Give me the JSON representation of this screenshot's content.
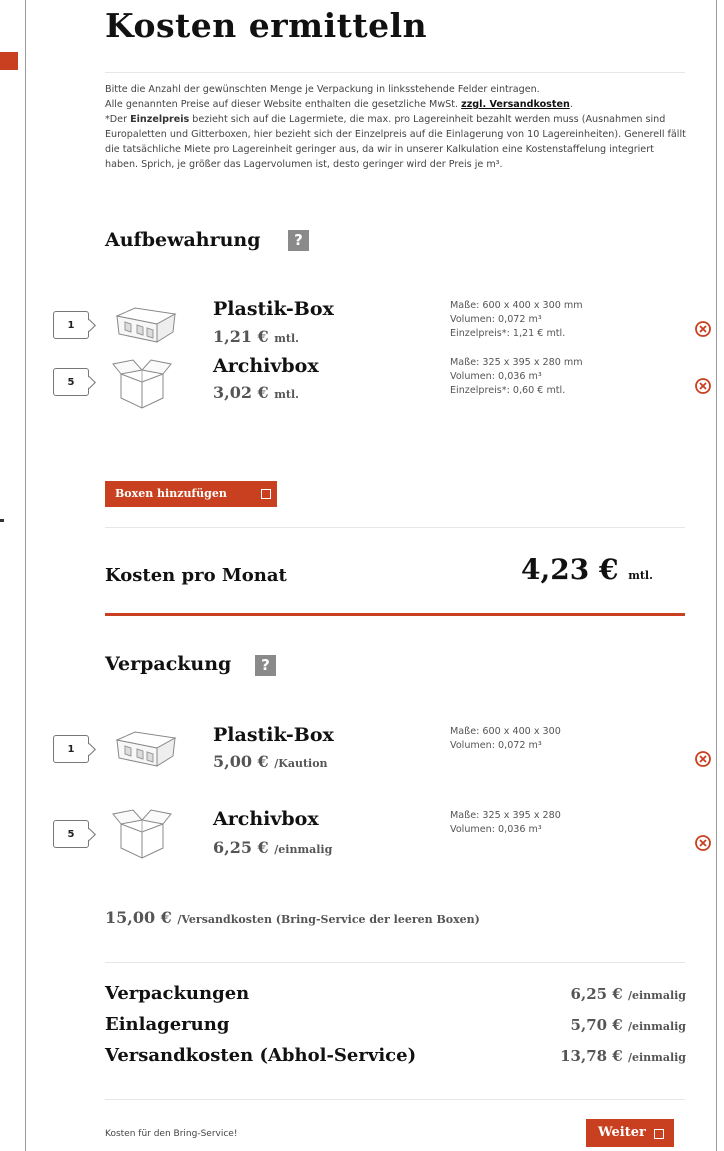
{
  "page_title": "Kosten ermitteln",
  "intro": {
    "line1": "Bitte die Anzahl der gewünschten Menge je Verpackung in linksstehende Felder eintragen.",
    "line2_pre": "Alle genannten Preise auf dieser Website enthalten die gesetzliche MwSt. ",
    "line2_link": "zzgl. Versandkosten",
    "line2_post": ".",
    "line3_pre": "*Der ",
    "line3_bold": "Einzelpreis",
    "line3_post": " bezieht sich auf die Lagermiete, die max. pro Lagereinheit bezahlt werden muss (Ausnahmen sind Europaletten und Gitterboxen, hier bezieht sich der Einzelpreis auf die Einlagerung von 10 Lagereinheiten). Generell fällt die tatsächliche Miete pro Lagereinheit geringer aus, da wir in unserer Kalkulation eine Kostenstaffelung integriert haben. Sprich, je größer das Lagervolumen ist, desto geringer wird der Preis je m³."
  },
  "storage": {
    "title": "Aufbewahrung",
    "help": "?",
    "items": [
      {
        "qty": "1",
        "name": "Plastik-Box",
        "price": "1,21 €",
        "unit": "mtl.",
        "spec1": "Maße: 600 x 400 x 300 mm",
        "spec2": "Volumen: 0,072 m³",
        "spec3": "Einzelpreis*: 1,21 € mtl."
      },
      {
        "qty": "5",
        "name": "Archivbox",
        "price": "3,02 €",
        "unit": "mtl.",
        "spec1": "Maße: 325 x 395 x 280 mm",
        "spec2": "Volumen: 0,036 m³",
        "spec3": "Einzelpreis*: 0,60 € mtl."
      }
    ],
    "add_button": "Boxen hinzufügen"
  },
  "monthly": {
    "label": "Kosten pro Monat",
    "value": "4,23 €",
    "unit": "mtl."
  },
  "packaging": {
    "title": "Verpackung",
    "help": "?",
    "items": [
      {
        "qty": "1",
        "name": "Plastik-Box",
        "price": "5,00 €",
        "unit": "/Kaution",
        "spec1": "Maße: 600 x 400 x 300",
        "spec2": "Volumen: 0,072 m³"
      },
      {
        "qty": "5",
        "name": "Archivbox",
        "price": "6,25 €",
        "unit": "/einmalig",
        "spec1": "Maße: 325 x 395 x 280",
        "spec2": "Volumen: 0,036 m³"
      }
    ],
    "shipping_value": "15,00 €",
    "shipping_text": "/Versandkosten (Bring-Service der leeren Boxen)"
  },
  "summary": [
    {
      "label": "Verpackungen",
      "value": "6,25 €",
      "unit": "/einmalig"
    },
    {
      "label": "Einlagerung",
      "value": "5,70 €",
      "unit": "/einmalig"
    },
    {
      "label": "Versandkosten (Abhol-Service)",
      "value": "13,78 €",
      "unit": "/einmalig"
    }
  ],
  "footer": {
    "note": "Kosten für den Bring-Service!",
    "next_button": "Weiter"
  },
  "colors": {
    "accent": "#c8401f",
    "help_bg": "#8a8a8a"
  }
}
